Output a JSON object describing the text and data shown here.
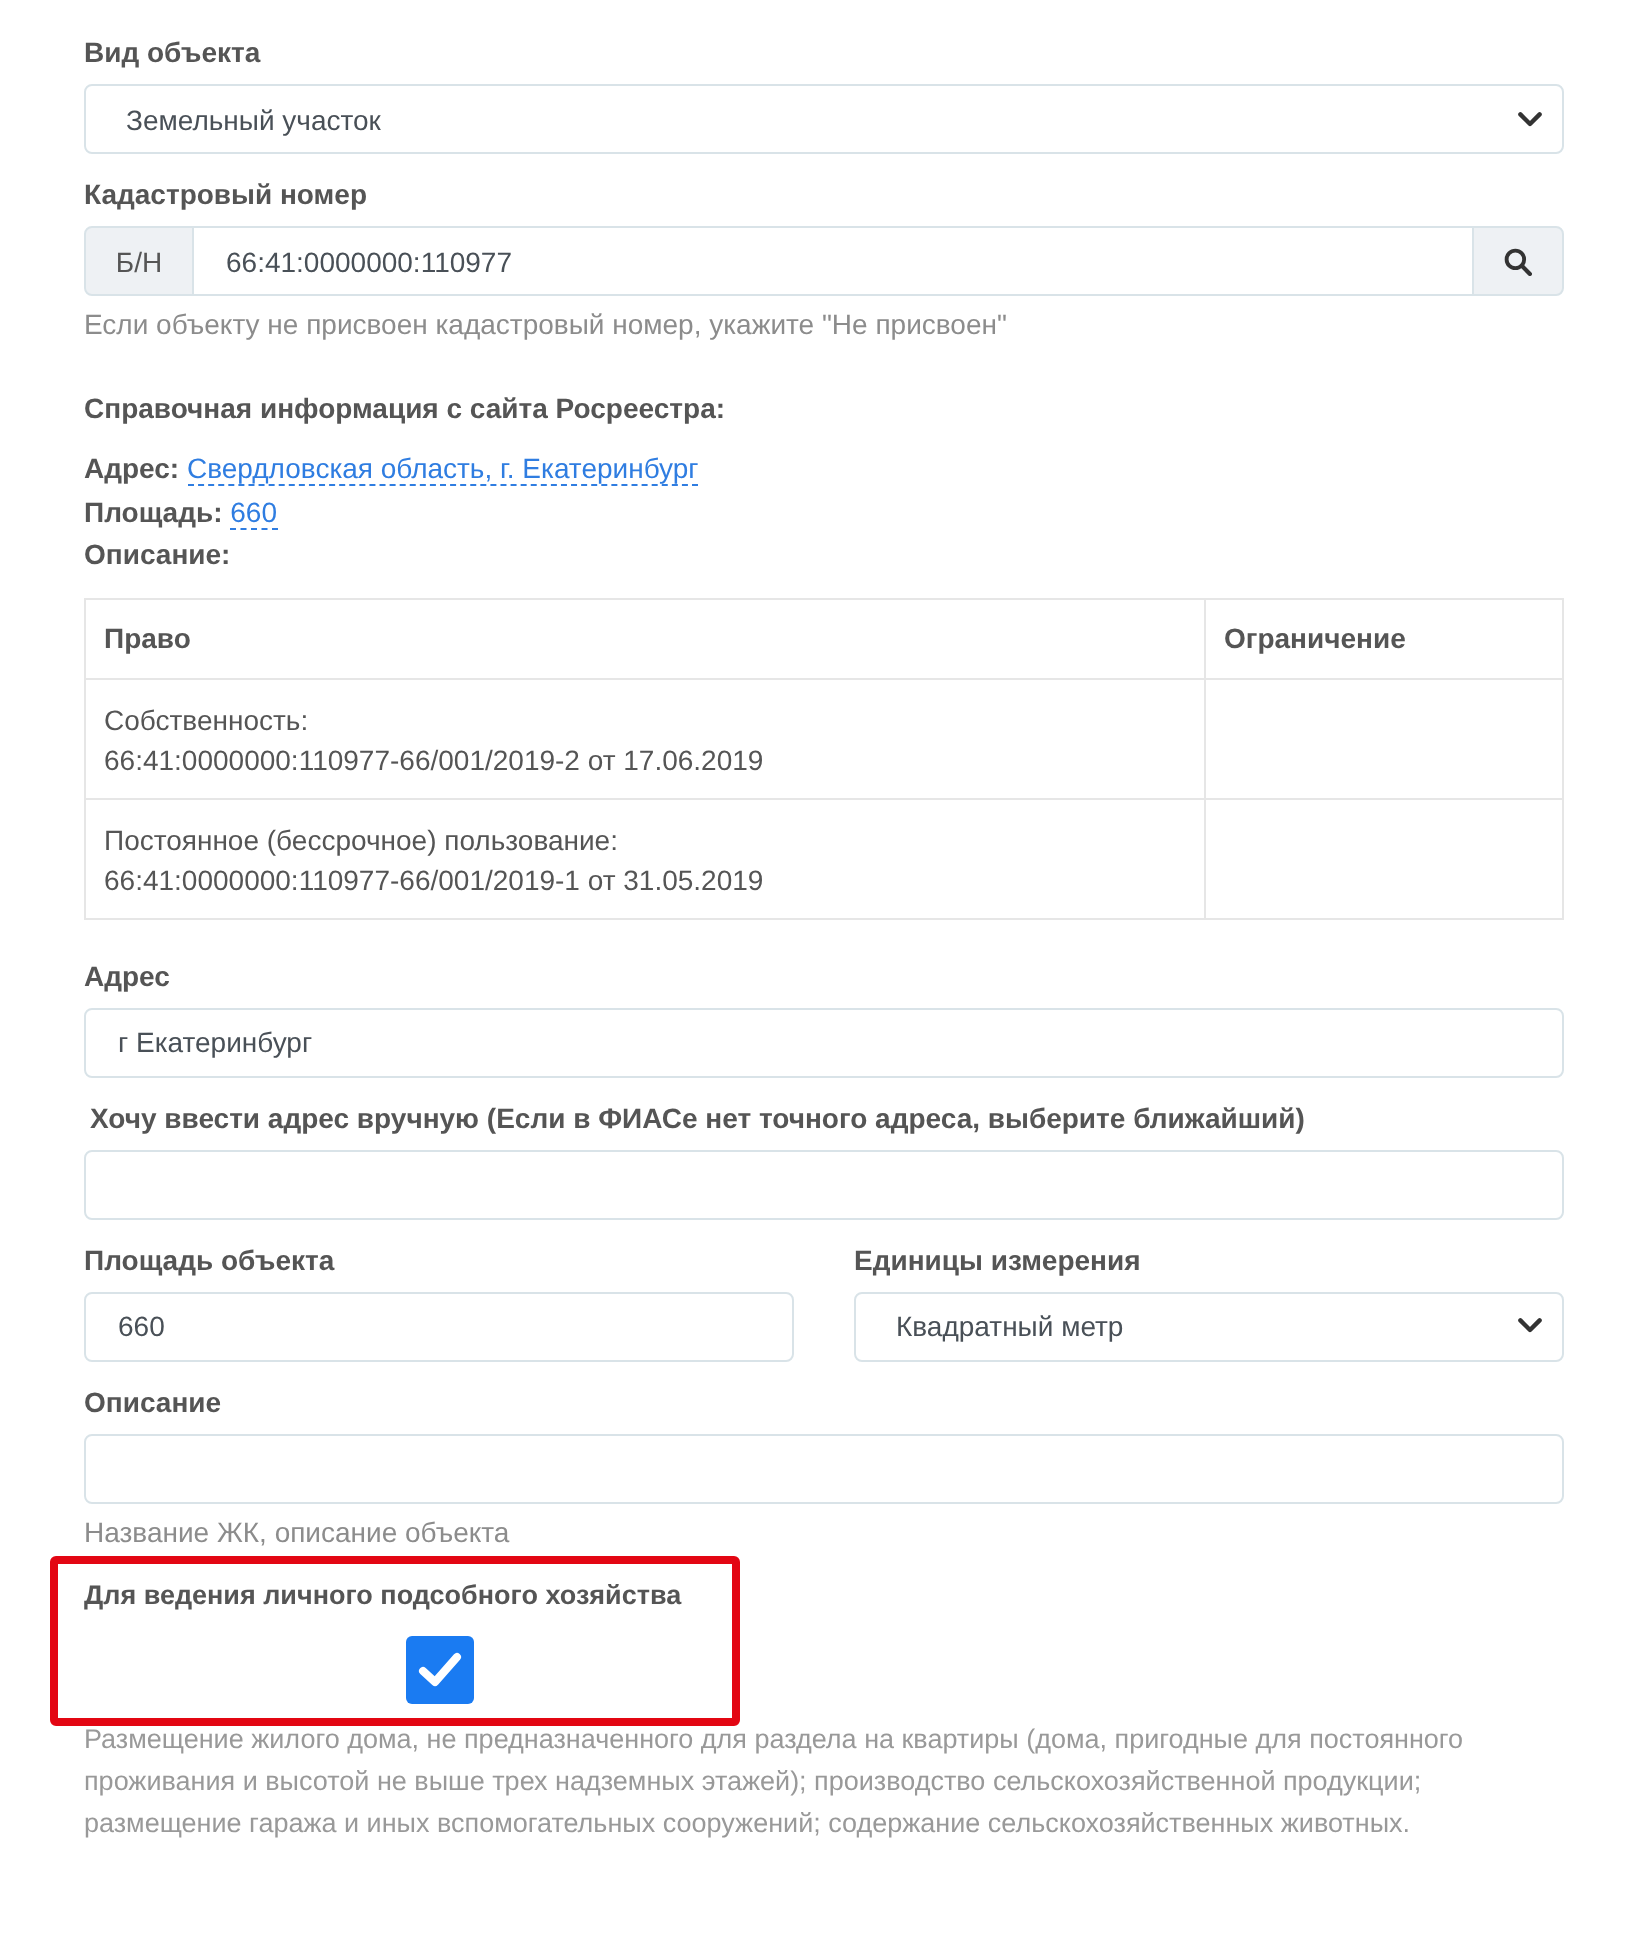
{
  "object_type": {
    "label": "Вид объекта",
    "value": "Земельный участок"
  },
  "cadastral_number": {
    "label": "Кадастровый номер",
    "prefix": "Б/Н",
    "value": "66:41:0000000:110977",
    "help": "Если объекту не присвоен кадастровый номер, укажите \"Не присвоен\""
  },
  "rosreestr": {
    "title": "Справочная информация с сайта Росреестра:",
    "fields": [
      {
        "label": "Адрес:",
        "value": "Свердловская область, г. Екатеринбург"
      },
      {
        "label": "Площадь:",
        "value": "660"
      },
      {
        "label": "Описание:"
      }
    ],
    "table": {
      "columns": [
        "Право",
        "Ограничение"
      ],
      "rows": [
        {
          "cells": [
            "Собственность:\n66:41:0000000:110977-66/001/2019-2 от 17.06.2019"
          ]
        },
        {
          "cells": [
            "Постоянное (бессрочное) пользование:\n66:41:0000000:110977-66/001/2019-1 от 31.05.2019"
          ]
        }
      ]
    }
  },
  "address": {
    "label": "Адрес",
    "value": "г Екатеринбург"
  },
  "manual_address": {
    "label": "Хочу ввести адрес вручную (Если в ФИАСе нет точного адреса, выберите ближайший)"
  },
  "area": {
    "label": "Площадь объекта",
    "value": "660"
  },
  "units": {
    "label": "Единицы измерения",
    "value": "Квадратный метр"
  },
  "description": {
    "label": "Описание",
    "help": "Название ЖК, описание объекта"
  },
  "land_use": {
    "label": "Для ведения личного подсобного хозяйства",
    "checked": true,
    "highlighted": true,
    "description": "Размещение жилого дома, не предназначенного для раздела на квартиры (дома, пригодные для постоянного проживания и высотой не выше трех надземных этажей); производство сельскохозяйственной продукции; размещение гаража и иных вспомогательных сооружений; содержание сельскохозяйственных животных."
  }
}
